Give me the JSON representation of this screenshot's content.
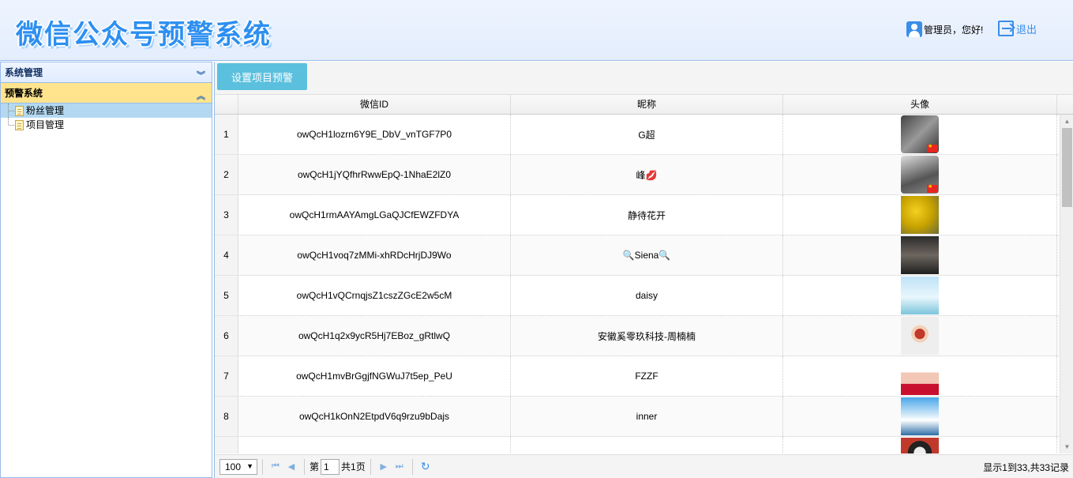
{
  "header": {
    "title": "微信公众号预警系统",
    "greeting": "管理员，您好!",
    "logout_label": "退出"
  },
  "sidebar": {
    "sections": [
      {
        "label": "系统管理"
      },
      {
        "label": "预警系统"
      }
    ],
    "items": [
      {
        "label": "粉丝管理"
      },
      {
        "label": "项目管理"
      }
    ]
  },
  "toolbar": {
    "set_alert_label": "设置项目预警"
  },
  "grid": {
    "columns": [
      "微信ID",
      "昵称",
      "头像"
    ],
    "rows": [
      {
        "num": "1",
        "id": "owQcH1lozrn6Y9E_DbV_vnTGF7P0",
        "nick": "G超"
      },
      {
        "num": "2",
        "id": "owQcH1jYQfhrRwwEpQ-1NhaE2lZ0",
        "nick": "峰💋"
      },
      {
        "num": "3",
        "id": "owQcH1rmAAYAmgLGaQJCfEWZFDYA",
        "nick": "静待花开"
      },
      {
        "num": "4",
        "id": "owQcH1voq7zMMi-xhRDcHrjDJ9Wo",
        "nick": "🔍Siena🔍"
      },
      {
        "num": "5",
        "id": "owQcH1vQCrnqjsZ1cszZGcE2w5cM",
        "nick": "daisy"
      },
      {
        "num": "6",
        "id": "owQcH1q2x9ycR5Hj7EBoz_gRtlwQ",
        "nick": "安徽奚零玖科技-周楠楠"
      },
      {
        "num": "7",
        "id": "owQcH1mvBrGgjfNGWuJ7t5ep_PeU",
        "nick": "FZZF"
      },
      {
        "num": "8",
        "id": "owQcH1kOnN2EtpdV6q9rzu9bDajs",
        "nick": "inner"
      }
    ]
  },
  "pager": {
    "page_size": "100",
    "page_prefix": "第",
    "page_value": "1",
    "page_suffix": "共1页",
    "info": "显示1到33,共33记录"
  },
  "colors": {
    "accent": "#5bc0de",
    "header_border": "#99bbe8",
    "active_section": "#ffe48d",
    "selected_item": "#b3d9f2"
  },
  "icons": {
    "user": "user-icon",
    "logout": "logout-icon",
    "collapse": "chevron-double-down-icon",
    "expand": "chevron-double-up-icon",
    "file": "file-icon"
  }
}
